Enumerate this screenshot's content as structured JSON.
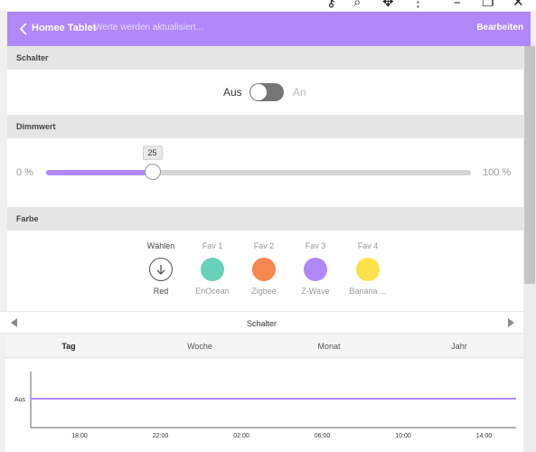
{
  "header": {
    "title": "Homee Tablet",
    "status": "Werte werden aktualisiert...",
    "edit_label": "Bearbeiten",
    "background_color": "#b088f9"
  },
  "sections": {
    "switch_title": "Schalter",
    "dim_title": "Dimmwert",
    "color_title": "Farbe"
  },
  "toggle": {
    "off_label": "Aus",
    "on_label": "An",
    "state": "off"
  },
  "slider": {
    "min_label": "0 %",
    "max_label": "100 %",
    "value": 25,
    "value_label": "25",
    "accent": "#b088f9"
  },
  "colors": [
    {
      "top": "Wählen",
      "bottom": "Red",
      "kind": "choose",
      "icon": "arrow-down-circle-icon"
    },
    {
      "top": "Fav 1",
      "bottom": "EnOcean",
      "color": "#66d2b9"
    },
    {
      "top": "Fav 2",
      "bottom": "Zigbee",
      "color": "#f5874f"
    },
    {
      "top": "Fav 3",
      "bottom": "Z-Wave",
      "color": "#b088f9"
    },
    {
      "top": "Fav 4",
      "bottom": "Banana ...",
      "color": "#fbe14a"
    }
  ],
  "history": {
    "title": "Schalter",
    "tabs": [
      "Tag",
      "Woche",
      "Monat",
      "Jahr"
    ],
    "active_tab": "Tag"
  },
  "chart_data": {
    "type": "line",
    "x": [
      "18:00",
      "22:00",
      "02:00",
      "06:00",
      "10:00",
      "14:00"
    ],
    "y_categories": [
      "Aus"
    ],
    "series": [
      {
        "values": [
          "Aus",
          "Aus",
          "Aus",
          "Aus",
          "Aus",
          "Aus"
        ],
        "color": "#b088f9"
      }
    ]
  },
  "icons": {
    "back": "chevron-left-icon",
    "prev": "triangle-left-icon",
    "next": "triangle-right-icon"
  }
}
